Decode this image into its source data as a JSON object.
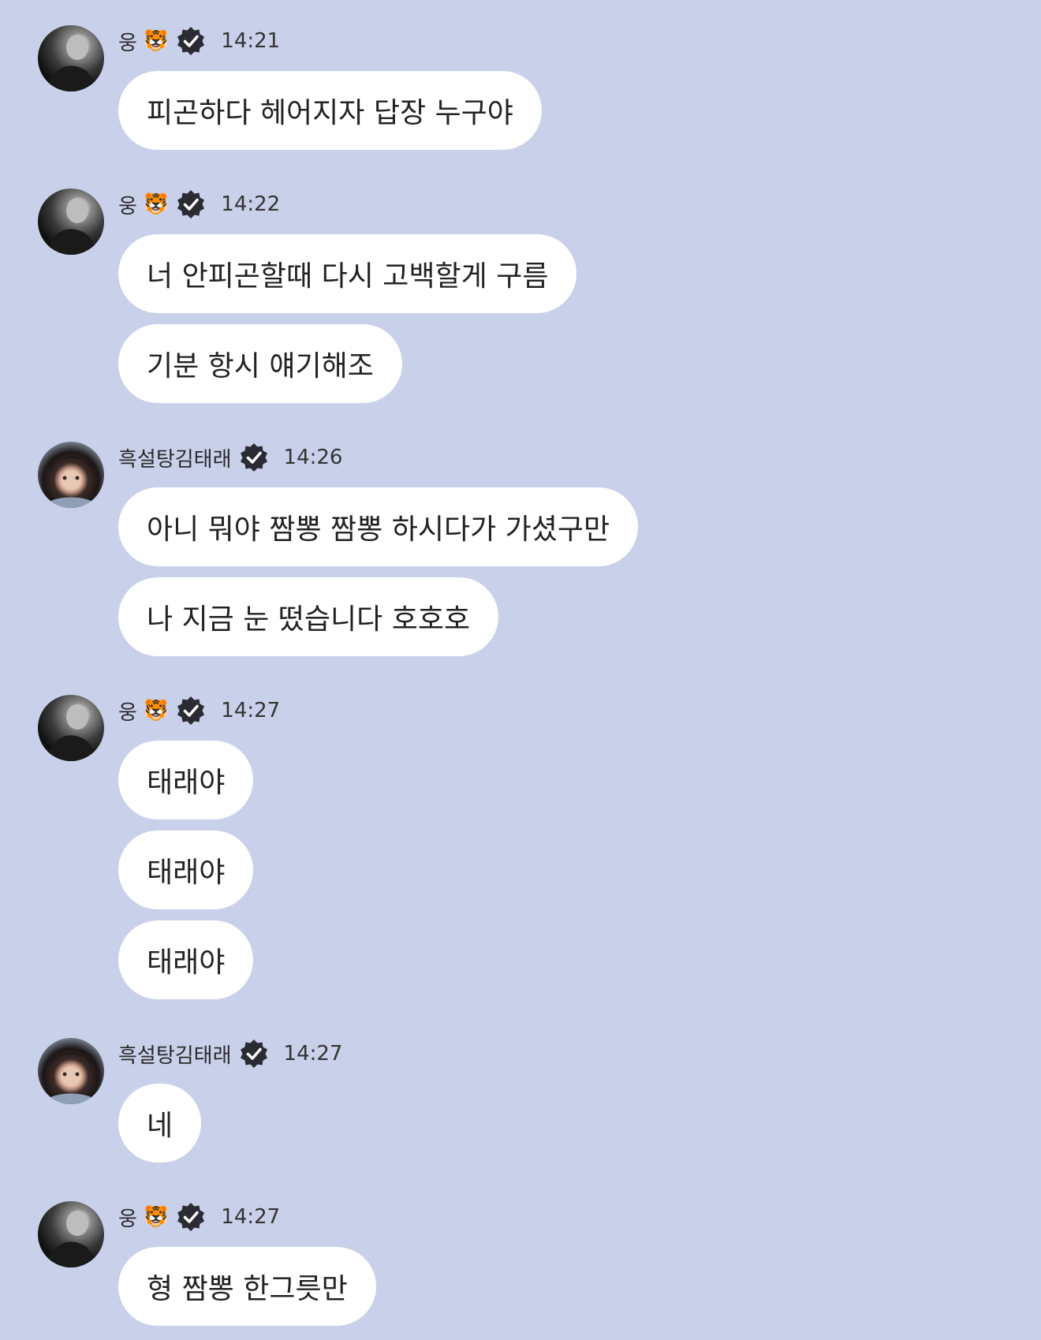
{
  "colors": {
    "background": "#c9d0ea",
    "bubble": "#ffffff",
    "badge": "#2b2b33"
  },
  "messages": [
    {
      "sender": "웅",
      "emoji": "🐯",
      "avatar": "ung",
      "time": "14:21",
      "texts": [
        "피곤하다 헤어지자 답장 누구야"
      ]
    },
    {
      "sender": "웅",
      "emoji": "🐯",
      "avatar": "ung",
      "time": "14:22",
      "texts": [
        "너 안피곤할때 다시 고백할게 구름",
        "기분 항시 얘기해조"
      ]
    },
    {
      "sender": "흑설탕김태래",
      "emoji": "",
      "avatar": "tae",
      "time": "14:26",
      "texts": [
        "아니 뭐야 짬뽕 짬뽕 하시다가 가셨구만",
        "나 지금 눈 떴습니다 호호호"
      ]
    },
    {
      "sender": "웅",
      "emoji": "🐯",
      "avatar": "ung",
      "time": "14:27",
      "texts": [
        "태래야",
        "태래야",
        "태래야"
      ]
    },
    {
      "sender": "흑설탕김태래",
      "emoji": "",
      "avatar": "tae",
      "time": "14:27",
      "texts": [
        "네"
      ]
    },
    {
      "sender": "웅",
      "emoji": "🐯",
      "avatar": "ung",
      "time": "14:27",
      "texts": [
        "형 짬뽕 한그릇만"
      ]
    }
  ]
}
